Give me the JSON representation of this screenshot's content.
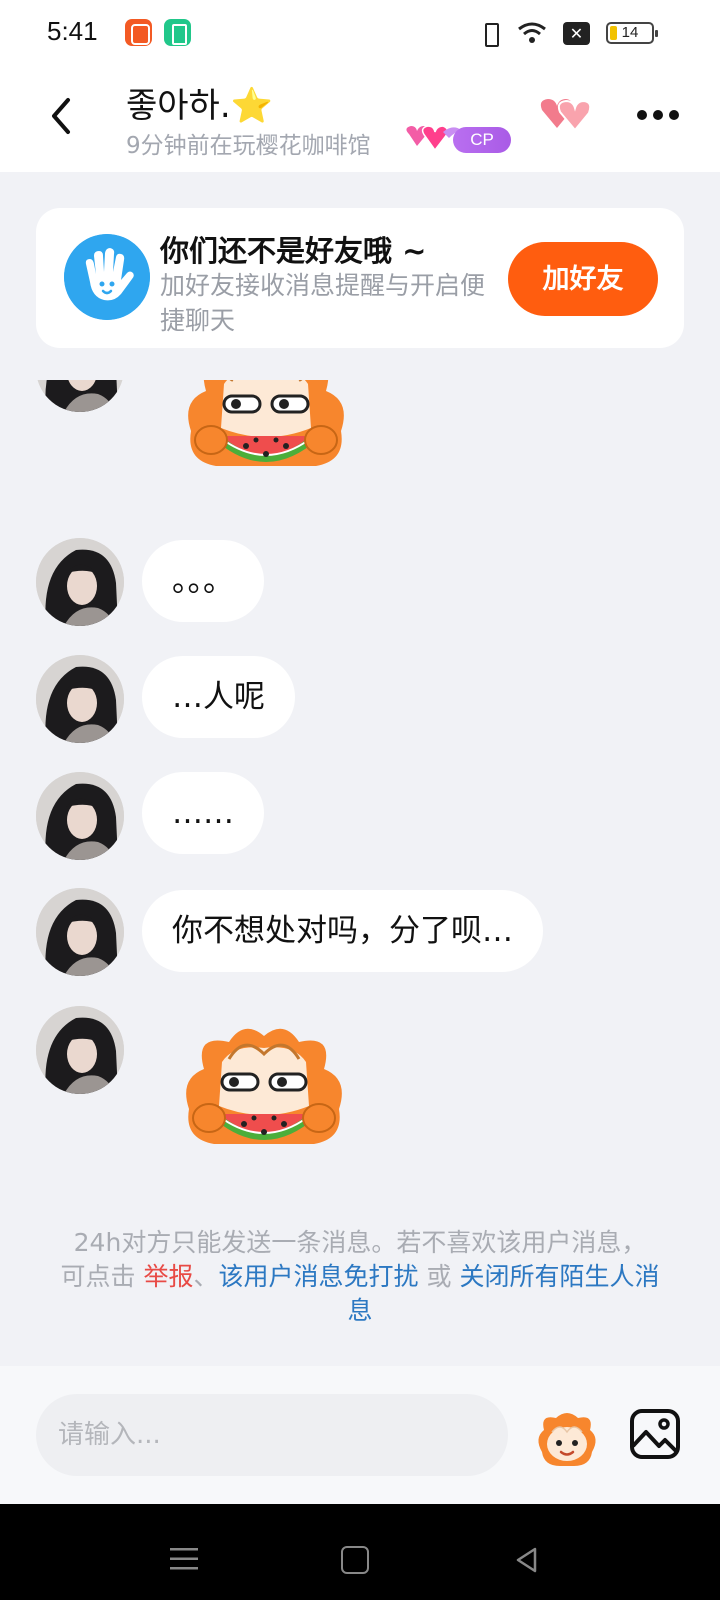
{
  "status_bar": {
    "time": "5:41",
    "battery": "14",
    "icons": [
      "app-notification-icon",
      "battery-app-icon",
      "vibrate-icon",
      "wifi-icon",
      "sim-off-icon",
      "battery-icon"
    ]
  },
  "header": {
    "name": "좋아하.",
    "star": "⭐",
    "subtitle": "9分钟前在玩樱花咖啡馆",
    "cp_tag": "CP",
    "back_icon": "back-chevron-icon",
    "more_icon": "more-dots-icon"
  },
  "friend_banner": {
    "title": "你们还不是好友哦 ~",
    "description": "加好友接收消息提醒与开启便捷聊天",
    "button": "加好友"
  },
  "messages": [
    {
      "type": "sticker",
      "sticker": "watermelon-mascot-sticker"
    },
    {
      "type": "text",
      "text": "。。。"
    },
    {
      "type": "text",
      "text": "…人呢"
    },
    {
      "type": "text",
      "text": "……"
    },
    {
      "type": "text",
      "text": "你不想处对吗，分了呗…"
    },
    {
      "type": "sticker",
      "sticker": "watermelon-mascot-sticker"
    }
  ],
  "notice": {
    "line1": "24h对方只能发送一条消息。若不喜欢该用户消息，",
    "prefix": "可点击 ",
    "report": "举报",
    "sep": "、",
    "mute_user": "该用户消息免打扰",
    "or": " 或 ",
    "close_strangers": "关闭所有陌生人消息"
  },
  "input_bar": {
    "placeholder": "请输入...",
    "emoji_icon": "mascot-emoji-icon",
    "image_icon": "image-icon"
  },
  "colors": {
    "accent_orange": "#ff5d0f",
    "link_blue": "#2c78c2",
    "report_red": "#e84a45",
    "background": "#f1f2f6"
  }
}
